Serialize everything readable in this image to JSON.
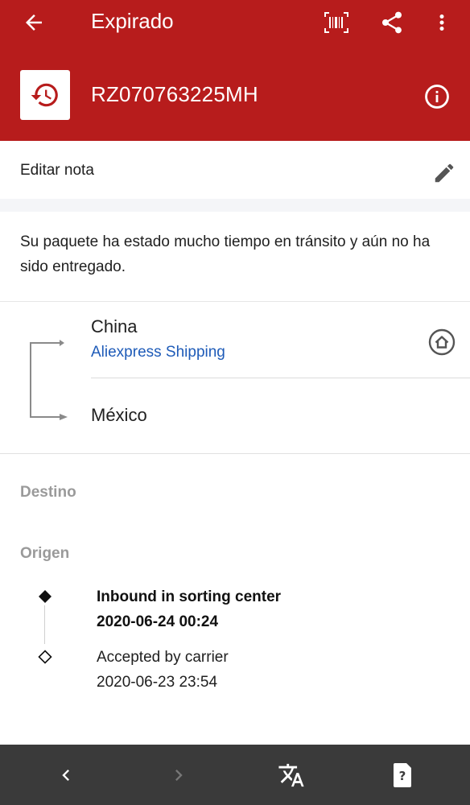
{
  "header": {
    "title": "Expirado",
    "tracking_number": "RZ070763225MH",
    "bg_color": "#b71c1c"
  },
  "note": {
    "edit_label": "Editar nota"
  },
  "status_message": "Su paquete ha estado mucho tiempo en tránsito y aún no ha sido entregado.",
  "route": {
    "origin_country": "China",
    "carrier": "Aliexpress Shipping",
    "destination_country": "México",
    "carrier_color": "#1e5bb8"
  },
  "sections": {
    "destination_label": "Destino",
    "origin_label": "Origen"
  },
  "events": [
    {
      "title": "Inbound in sorting center",
      "datetime": "2020-06-24 00:24",
      "emphasis": "bold"
    },
    {
      "title": "Accepted by carrier",
      "datetime": "2020-06-23 23:54",
      "emphasis": "normal"
    }
  ],
  "bottom_bar": {
    "icons": [
      "chevron-left-icon",
      "chevron-right-icon",
      "translate-icon",
      "help-card-icon"
    ]
  }
}
